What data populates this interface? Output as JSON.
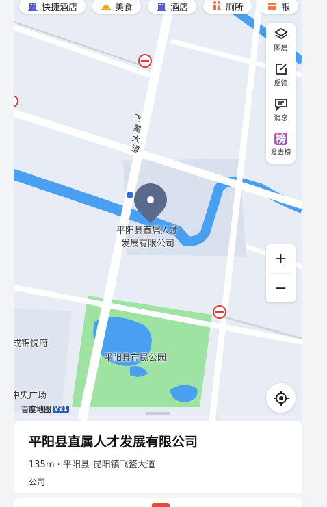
{
  "categories": [
    {
      "label": "快捷酒店",
      "icon": "hotel-icon",
      "color": "#5b5bd6"
    },
    {
      "label": "美食",
      "icon": "food-icon",
      "color": "#f5a623"
    },
    {
      "label": "酒店",
      "icon": "hotel-icon",
      "color": "#5b5bd6"
    },
    {
      "label": "厕所",
      "icon": "toilet-icon",
      "color": "#e8734a"
    },
    {
      "label": "银",
      "icon": "bank-icon",
      "color": "#f07a3a"
    }
  ],
  "tools": {
    "layers": "图层",
    "feedback": "反馈",
    "messages": "消息",
    "ranking": "爱去榜",
    "ranking_glyph": "榜"
  },
  "map": {
    "road_label": "飞鳌大道",
    "road_chars": [
      "飞",
      "鳌",
      "大",
      "道"
    ],
    "poi_line1": "平阳县直属人才",
    "poi_line2": "发展有限公司",
    "park": "平阳县市民公园",
    "mall": "成锦悦府",
    "plaza": "中央广场"
  },
  "zoom": {
    "in": "+",
    "out": "−"
  },
  "logo": {
    "text": "百度地图",
    "version": "V21"
  },
  "place": {
    "name": "平阳县直属人才发展有限公司",
    "info": "135m · 平阳县-昆阳镇飞鳌大道",
    "category": "公司"
  },
  "colors": {
    "water": "#4aa0f0",
    "park": "#9fe3a3",
    "marker": "#5a6a8c",
    "block": "#d9e0ee",
    "road": "#ffffff",
    "location_dot": "#2f6ce0",
    "no_entry": "#e23a3a"
  }
}
